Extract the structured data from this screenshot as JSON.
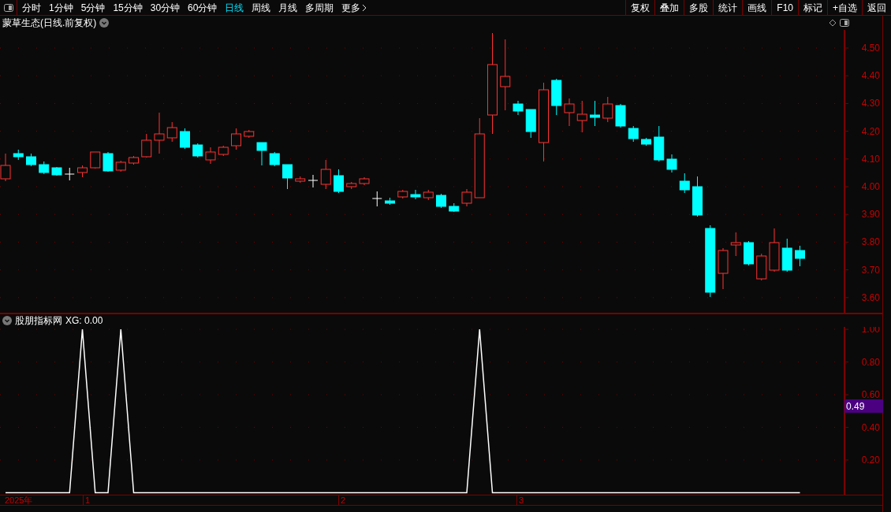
{
  "toolbar": {
    "periods": [
      {
        "label": "分时",
        "selected": false
      },
      {
        "label": "1分钟",
        "selected": false
      },
      {
        "label": "5分钟",
        "selected": false
      },
      {
        "label": "15分钟",
        "selected": false
      },
      {
        "label": "30分钟",
        "selected": false
      },
      {
        "label": "60分钟",
        "selected": false
      },
      {
        "label": "日线",
        "selected": true
      },
      {
        "label": "周线",
        "selected": false
      },
      {
        "label": "月线",
        "selected": false
      },
      {
        "label": "多周期",
        "selected": false
      }
    ],
    "more": "更多",
    "actions": [
      "复权",
      "叠加",
      "多股",
      "统计",
      "画线",
      "F10",
      "标记",
      "+自选",
      "返回"
    ]
  },
  "chart": {
    "title": "蒙草生态(日线.前复权)",
    "price_ticks": [
      "4.50",
      "4.40",
      "4.30",
      "4.20",
      "4.10",
      "4.00",
      "3.90",
      "3.80",
      "3.70",
      "3.60"
    ]
  },
  "indicator": {
    "name": "股朋指标网",
    "reading": "XG: 0.00",
    "cursor_label": "0.49",
    "chart_data": {
      "type": "line",
      "grid": true,
      "series": [
        {
          "color": "#ffffff",
          "values": [
            0,
            0,
            0,
            0,
            0,
            0,
            1,
            0,
            0,
            1,
            0,
            0,
            0,
            0,
            0,
            0,
            0,
            0,
            0,
            0,
            0,
            0,
            0,
            0,
            0,
            0,
            0,
            0,
            0,
            0,
            0,
            0,
            0,
            0,
            0,
            0,
            0,
            1,
            0,
            0,
            0,
            0,
            0,
            0,
            0,
            0,
            0,
            0,
            0,
            0,
            0,
            0,
            0,
            0,
            0,
            0,
            0,
            0,
            0,
            0,
            0,
            0,
            0
          ]
        }
      ],
      "ylim": [
        0,
        1.015
      ],
      "yticks": [
        {
          "value": 1,
          "label": "1.00"
        },
        {
          "value": 0.8,
          "label": "0.80"
        },
        {
          "value": 0.6,
          "label": "0.60"
        },
        {
          "value": 0.4,
          "label": "0.40"
        },
        {
          "value": 0.2,
          "label": "0.20"
        }
      ]
    }
  },
  "date_axis": {
    "year": "2025年",
    "months": [
      "1",
      "2",
      "3"
    ]
  }
}
